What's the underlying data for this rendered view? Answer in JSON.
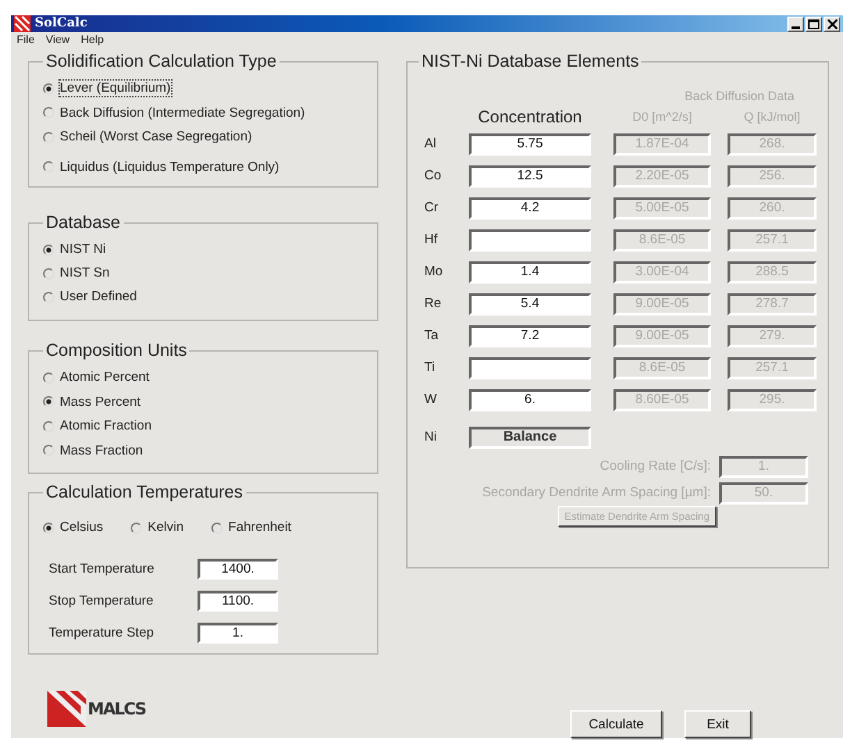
{
  "window": {
    "title": "SolCalc"
  },
  "menu": [
    "File",
    "View",
    "Help"
  ],
  "calc_type": {
    "title": "Solidification Calculation Type",
    "options": [
      {
        "label": "Lever (Equilibrium)",
        "selected": true
      },
      {
        "label": "Back Diffusion (Intermediate Segregation)",
        "selected": false
      },
      {
        "label": "Scheil (Worst Case Segregation)",
        "selected": false
      },
      {
        "label": "Liquidus (Liquidus Temperature Only)",
        "selected": false
      }
    ]
  },
  "database": {
    "title": "Database",
    "options": [
      {
        "label": "NIST Ni",
        "selected": true
      },
      {
        "label": "NIST Sn",
        "selected": false
      },
      {
        "label": "User Defined",
        "selected": false
      }
    ]
  },
  "composition_units": {
    "title": "Composition Units",
    "options": [
      {
        "label": "Atomic Percent",
        "selected": false
      },
      {
        "label": "Mass Percent",
        "selected": true
      },
      {
        "label": "Atomic Fraction",
        "selected": false
      },
      {
        "label": "Mass Fraction",
        "selected": false
      }
    ]
  },
  "temperatures": {
    "title": "Calculation Temperatures",
    "units": [
      {
        "label": "Celsius",
        "selected": true
      },
      {
        "label": "Kelvin",
        "selected": false
      },
      {
        "label": "Fahrenheit",
        "selected": false
      }
    ],
    "fields": [
      {
        "label": "Start Temperature",
        "value": "1400."
      },
      {
        "label": "Stop Temperature",
        "value": "1100."
      },
      {
        "label": "Temperature Step",
        "value": "1."
      }
    ]
  },
  "elements": {
    "title": "NIST-Ni Database Elements",
    "back_diffusion_heading": "Back Diffusion Data",
    "columns": [
      "Concentration",
      "D0 [m^2/s]",
      "Q [kJ/mol]"
    ],
    "rows": [
      {
        "element": "Al",
        "concentration": "5.75",
        "d0": "1.87E-04",
        "q": "268."
      },
      {
        "element": "Co",
        "concentration": "12.5",
        "d0": "2.20E-05",
        "q": "256."
      },
      {
        "element": "Cr",
        "concentration": "4.2",
        "d0": "5.00E-05",
        "q": "260."
      },
      {
        "element": "Hf",
        "concentration": "",
        "d0": "8.6E-05",
        "q": "257.1"
      },
      {
        "element": "Mo",
        "concentration": "1.4",
        "d0": "3.00E-04",
        "q": "288.5"
      },
      {
        "element": "Re",
        "concentration": "5.4",
        "d0": "9.00E-05",
        "q": "278.7"
      },
      {
        "element": "Ta",
        "concentration": "7.2",
        "d0": "9.00E-05",
        "q": "279."
      },
      {
        "element": "Ti",
        "concentration": "",
        "d0": "8.6E-05",
        "q": "257.1"
      },
      {
        "element": "W",
        "concentration": "6.",
        "d0": "8.60E-05",
        "q": "295."
      }
    ],
    "balance": {
      "element": "Ni",
      "value": "Balance"
    },
    "cooling_rate": {
      "label": "Cooling Rate [C/s]:",
      "value": "1.",
      "disabled": true
    },
    "arm_spacing": {
      "label": "Secondary Dendrite Arm Spacing [µm]:",
      "value": "50.",
      "disabled": true
    },
    "estimate_button": {
      "label": "Estimate Dendrite Arm Spacing",
      "disabled": true
    }
  },
  "logo": {
    "text": "MALCS"
  },
  "buttons": [
    "Calculate",
    "Exit"
  ]
}
